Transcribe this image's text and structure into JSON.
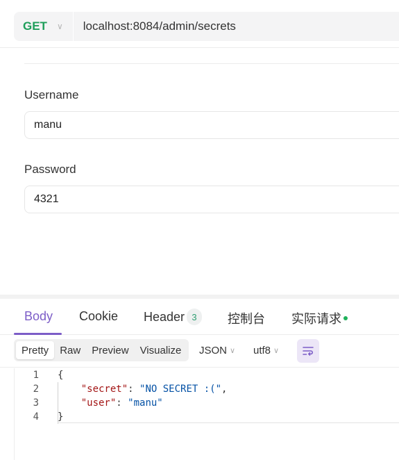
{
  "request": {
    "method": "GET",
    "url": "localhost:8084/admin/secrets"
  },
  "form": {
    "username_label": "Username",
    "username_value": "manu",
    "password_label": "Password",
    "password_value": "4321"
  },
  "response_tabs": {
    "body": "Body",
    "cookie": "Cookie",
    "header": "Header",
    "header_count": "3",
    "console": "控制台",
    "actual_request": "实际请求"
  },
  "toolbar": {
    "view_modes": [
      "Pretty",
      "Raw",
      "Preview",
      "Visualize"
    ],
    "format": "JSON",
    "encoding": "utf8",
    "wrap_icon": "text-wrap-icon"
  },
  "code": {
    "line_numbers": [
      "1",
      "2",
      "3",
      "4"
    ],
    "open_brace": "{",
    "close_brace": "}",
    "key1": "\"secret\"",
    "val1": "\"NO SECRET :(\"",
    "key2": "\"user\"",
    "val2": "\"manu\""
  },
  "colors": {
    "method": "#1e9e5a",
    "accent": "#7c5dc7",
    "json_key": "#a31515",
    "json_string": "#0451a5"
  }
}
